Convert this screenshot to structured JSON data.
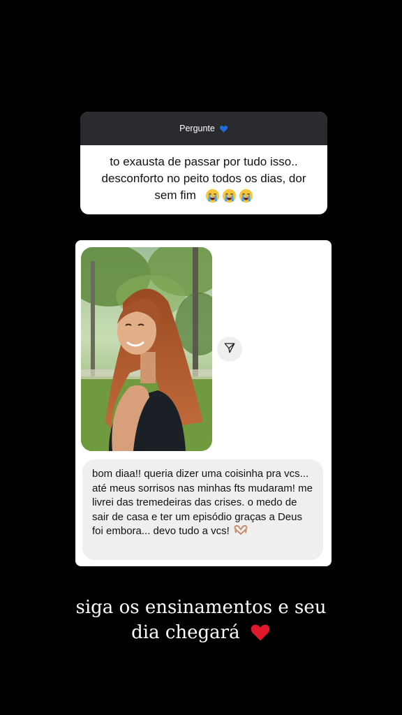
{
  "question_sticker": {
    "header_label": "Pergunte",
    "header_emoji": "blue-heart-icon",
    "text": "to exausta de passar por tudo isso.. desconforto no peito todos os dias, dor sem fim",
    "emojis": [
      "loudly-crying-face-icon",
      "loudly-crying-face-icon",
      "loudly-crying-face-icon"
    ]
  },
  "message_card": {
    "photo": "smiling-woman-in-park-photo",
    "share_icon": "send-icon",
    "message_text": "bom diaa!! queria dizer uma coisinha pra vcs... até meus sorrisos nas minhas fts mudaram! me livrei das tremedeiras das crises. o medo de sair de casa e ter um episódio graças a Deus foi embora... devo tudo a vcs!",
    "message_emoji": "heart-hands-icon"
  },
  "caption": {
    "line1": "siga os ensinamentos e seu",
    "line2": "dia chegará",
    "emoji": "red-heart-icon"
  },
  "colors": {
    "background": "#000000",
    "header_bg": "#2a2b2f",
    "bubble_bg": "#efefef",
    "heart_red": "#e0192a",
    "heart_blue": "#1d6fe0"
  }
}
